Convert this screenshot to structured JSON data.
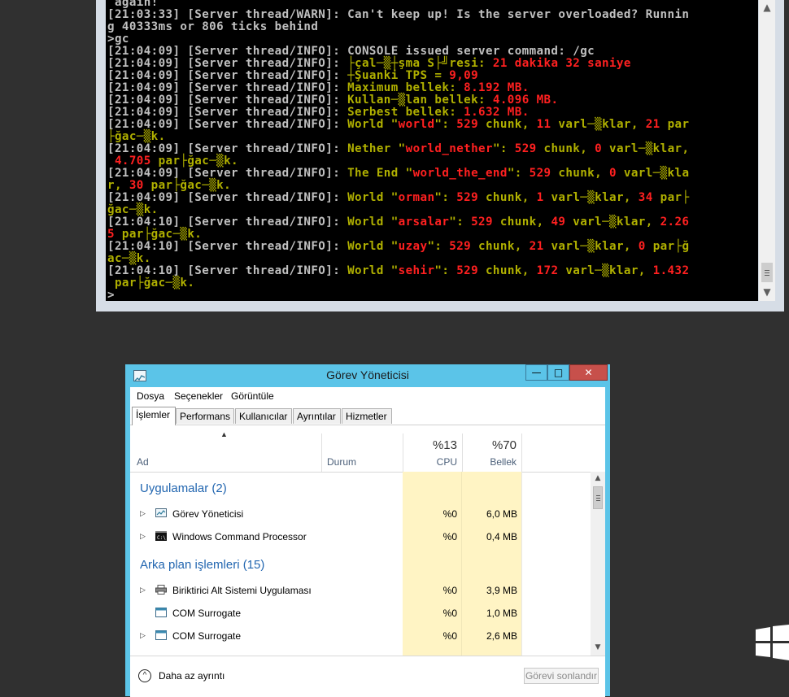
{
  "console": {
    "lines": [
      [
        {
          "t": " again!",
          "c": ""
        }
      ],
      [
        {
          "t": "[21:03:33] [Server thread/WARN]: Can't keep up! Is the server overloaded? Runnin",
          "c": ""
        }
      ],
      [
        {
          "t": "g 40333ms or 806 ticks behind",
          "c": ""
        }
      ],
      [
        {
          "t": ">gc",
          "c": ""
        }
      ],
      [
        {
          "t": "[21:04:09] [Server thread/INFO]: CONSOLE issued server command: /gc",
          "c": ""
        }
      ],
      [
        {
          "t": "[21:04:09] [Server thread/INFO]: ",
          "c": ""
        },
        {
          "t": "├çal─▒┼şma S├╝resi: ",
          "c": "yl"
        },
        {
          "t": "21 dakika 32 saniye",
          "c": "rd"
        }
      ],
      [
        {
          "t": "[21:04:09] [Server thread/INFO]: ",
          "c": ""
        },
        {
          "t": "┼Şuanki TPS = ",
          "c": "yl"
        },
        {
          "t": "9,09",
          "c": "rd"
        }
      ],
      [
        {
          "t": "[21:04:09] [Server thread/INFO]: ",
          "c": ""
        },
        {
          "t": "Maximum bellek: ",
          "c": "yl"
        },
        {
          "t": "8.192 MB.",
          "c": "rd"
        }
      ],
      [
        {
          "t": "[21:04:09] [Server thread/INFO]: ",
          "c": ""
        },
        {
          "t": "Kullan─▒lan bellek: ",
          "c": "yl"
        },
        {
          "t": "4.096 MB.",
          "c": "rd"
        }
      ],
      [
        {
          "t": "[21:04:09] [Server thread/INFO]: ",
          "c": ""
        },
        {
          "t": "Serbest bellek: ",
          "c": "yl"
        },
        {
          "t": "1.632 MB.",
          "c": "rd"
        }
      ],
      [
        {
          "t": "[21:04:09] [Server thread/INFO]: ",
          "c": ""
        },
        {
          "t": "World \"",
          "c": "yl"
        },
        {
          "t": "world",
          "c": "rd"
        },
        {
          "t": "\": ",
          "c": "yl"
        },
        {
          "t": "529",
          "c": "rd"
        },
        {
          "t": " chunk, ",
          "c": "yl"
        },
        {
          "t": "11",
          "c": "rd"
        },
        {
          "t": " varl─▒klar, ",
          "c": "yl"
        },
        {
          "t": "21",
          "c": "rd"
        },
        {
          "t": " par",
          "c": "yl"
        }
      ],
      [
        {
          "t": "├ğac─▒k.",
          "c": "yl"
        }
      ],
      [
        {
          "t": "[21:04:09] [Server thread/INFO]: ",
          "c": ""
        },
        {
          "t": "Nether \"",
          "c": "yl"
        },
        {
          "t": "world_nether",
          "c": "rd"
        },
        {
          "t": "\": ",
          "c": "yl"
        },
        {
          "t": "529",
          "c": "rd"
        },
        {
          "t": " chunk, ",
          "c": "yl"
        },
        {
          "t": "0",
          "c": "rd"
        },
        {
          "t": " varl─▒klar,",
          "c": "yl"
        }
      ],
      [
        {
          "t": " 4.705",
          "c": "rd"
        },
        {
          "t": " par├ğac─▒k.",
          "c": "yl"
        }
      ],
      [
        {
          "t": "[21:04:09] [Server thread/INFO]: ",
          "c": ""
        },
        {
          "t": "The End \"",
          "c": "yl"
        },
        {
          "t": "world_the_end",
          "c": "rd"
        },
        {
          "t": "\": ",
          "c": "yl"
        },
        {
          "t": "529",
          "c": "rd"
        },
        {
          "t": " chunk, ",
          "c": "yl"
        },
        {
          "t": "0",
          "c": "rd"
        },
        {
          "t": " varl─▒kla",
          "c": "yl"
        }
      ],
      [
        {
          "t": "r, ",
          "c": "yl"
        },
        {
          "t": "30",
          "c": "rd"
        },
        {
          "t": " par├ğac─▒k.",
          "c": "yl"
        }
      ],
      [
        {
          "t": "[21:04:09] [Server thread/INFO]: ",
          "c": ""
        },
        {
          "t": "World \"",
          "c": "yl"
        },
        {
          "t": "orman",
          "c": "rd"
        },
        {
          "t": "\": ",
          "c": "yl"
        },
        {
          "t": "529",
          "c": "rd"
        },
        {
          "t": " chunk, ",
          "c": "yl"
        },
        {
          "t": "1",
          "c": "rd"
        },
        {
          "t": " varl─▒klar, ",
          "c": "yl"
        },
        {
          "t": "34",
          "c": "rd"
        },
        {
          "t": " par├",
          "c": "yl"
        }
      ],
      [
        {
          "t": "ğac─▒k.",
          "c": "yl"
        }
      ],
      [
        {
          "t": "[21:04:10] [Server thread/INFO]: ",
          "c": ""
        },
        {
          "t": "World \"",
          "c": "yl"
        },
        {
          "t": "arsalar",
          "c": "rd"
        },
        {
          "t": "\": ",
          "c": "yl"
        },
        {
          "t": "529",
          "c": "rd"
        },
        {
          "t": " chunk, ",
          "c": "yl"
        },
        {
          "t": "49",
          "c": "rd"
        },
        {
          "t": " varl─▒klar, ",
          "c": "yl"
        },
        {
          "t": "2.26",
          "c": "rd"
        }
      ],
      [
        {
          "t": "5",
          "c": "rd"
        },
        {
          "t": " par├ğac─▒k.",
          "c": "yl"
        }
      ],
      [
        {
          "t": "[21:04:10] [Server thread/INFO]: ",
          "c": ""
        },
        {
          "t": "World \"",
          "c": "yl"
        },
        {
          "t": "uzay",
          "c": "rd"
        },
        {
          "t": "\": ",
          "c": "yl"
        },
        {
          "t": "529",
          "c": "rd"
        },
        {
          "t": " chunk, ",
          "c": "yl"
        },
        {
          "t": "21",
          "c": "rd"
        },
        {
          "t": " varl─▒klar, ",
          "c": "yl"
        },
        {
          "t": "0",
          "c": "rd"
        },
        {
          "t": " par├ğ",
          "c": "yl"
        }
      ],
      [
        {
          "t": "ac─▒k.",
          "c": "yl"
        }
      ],
      [
        {
          "t": "[21:04:10] [Server thread/INFO]: ",
          "c": ""
        },
        {
          "t": "World \"",
          "c": "yl"
        },
        {
          "t": "sehir",
          "c": "rd"
        },
        {
          "t": "\": ",
          "c": "yl"
        },
        {
          "t": "529",
          "c": "rd"
        },
        {
          "t": " chunk, ",
          "c": "yl"
        },
        {
          "t": "172",
          "c": "rd"
        },
        {
          "t": " varl─▒klar, ",
          "c": "yl"
        },
        {
          "t": "1.432",
          "c": "rd"
        }
      ],
      [
        {
          "t": " par├ğac─▒k.",
          "c": "yl"
        }
      ],
      [
        {
          "t": ">",
          "c": ""
        }
      ]
    ]
  },
  "taskmanager": {
    "title": "Görev Yöneticisi",
    "window_buttons": {
      "minimize": "—",
      "maximize": "□",
      "close": "✕"
    },
    "menu": [
      "Dosya",
      "Seçenekler",
      "Görüntüle"
    ],
    "tabs": [
      "İşlemler",
      "Performans",
      "Kullanıcılar",
      "Ayrıntılar",
      "Hizmetler"
    ],
    "active_tab": 0,
    "columns": {
      "name": "Ad",
      "status": "Durum",
      "cpu_total": "%13",
      "cpu": "CPU",
      "mem_total": "%70",
      "mem": "Bellek"
    },
    "groups": [
      {
        "label": "Uygulamalar (2)"
      },
      {
        "label": "Arka plan işlemleri (15)"
      }
    ],
    "rows": [
      {
        "name": "Görev Yöneticisi",
        "cpu": "%0",
        "mem": "6,0 MB",
        "icon": "task-manager-icon"
      },
      {
        "name": "Windows Command Processor",
        "cpu": "%0",
        "mem": "0,4 MB",
        "icon": "cmd-icon"
      },
      {
        "name": "Biriktirici Alt Sistemi Uygulaması",
        "cpu": "%0",
        "mem": "3,9 MB",
        "icon": "printer-icon"
      },
      {
        "name": "COM Surrogate",
        "cpu": "%0",
        "mem": "1,0 MB",
        "icon": "window-icon"
      },
      {
        "name": "COM Surrogate",
        "cpu": "%0",
        "mem": "2,6 MB",
        "icon": "window-icon"
      }
    ],
    "footer": {
      "less_details": "Daha az ayrıntı",
      "end_task": "Görevi sonlandır"
    },
    "colors": {
      "title_bar": "#5bc4e8",
      "close": "#c7504b",
      "heat": "#fff4c4",
      "group_text": "#2266b0"
    }
  }
}
